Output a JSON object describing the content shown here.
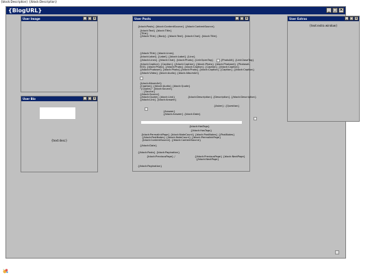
{
  "page": {
    "top_description": "{block:Description} {/block:Description}"
  },
  "main_window": {
    "title": "{BlogURL}"
  },
  "windows": {
    "user_image": {
      "title": "User Image"
    },
    "user_bio": {
      "title": "User Bio",
      "text": "{text:desc}"
    },
    "user_posts": {
      "title": "User Posts"
    },
    "user_extras": {
      "title": "User Extras",
      "text": "{text:extra window}"
    }
  },
  "posts": {
    "l01": "{block:Posts} {block:ContentSource} {/block:ContentSource}",
    "l02": "{block:Text} {block:Title}",
    "l03": "{Title}",
    "l04": "{/block:Title} {Body} {/block:Text} {block:Chat} {block:Title}",
    "l05": "{/block:Title} {block:Lines}",
    "l06": "{block:Label} {Label} {/block:Label} {Line}",
    "l07": "{/block:Lines} {/block:Chat} {block:Photo} {LinkOpenTag}",
    "l08": "{PhotoAlt} {LinkCloseTag}",
    "l09": "{block:Caption} {Caption} {/block:Caption} {/block:Photo} {block:Photoset} {Photoset-",
    "l10": "500} {block:Photo} {/block:Photo} {block:Caption} {Caption} {/block:Caption}",
    "l11": "{/block:Photoset} {block:Photo}{/block:Photo} {block:Caption} {Caption} {/block:Caption}",
    "l12": "{/block:Video} {block:Audio} {block:AlbumArt}",
    "l13": "{block:AlbumArt}",
    "l14": "{Caption} {/block:Audio} {block:Quote}",
    "l15": "\"{Quote}\" {block:Source}",
    "l16": "- {Source}",
    "l17": "{/block:Source}",
    "l18": "{/block:Quote} {block:Link}",
    "l19": "{block:Description} {Description} {/block:Description}",
    "l20": "{/block:Link} {block:Answer}",
    "l21": "{Asker}: {Question}",
    "l22": "{Answer}",
    "l23": "{/block:Answer} {block:Date}",
    "l24": "{block:HasTags}",
    "l25": "{/block:HasTags}",
    "l26": "{block:PermalinkPage} {block:NoteCount} {block:PostNotes} {/PostNotes}",
    "l27": "{/block:PostNotes} {/block:NoteCount} {/block:PermalinkPage}",
    "l28": "{block:ContentSource} {/block:ContentSource}",
    "l29": "{/block:Date}",
    "l30": "{/block:Posts} {block:Pagination}",
    "l31": "{block:PreviousPage} /",
    "l32": "{/block:PreviousPage} {block:NextPage}",
    "l33": "{/block:NextPage}",
    "l34": "{/block:Pagination}"
  },
  "icons": {
    "minimize": "_",
    "maximize": "□",
    "close": "×",
    "window_control_names": [
      "minimize-icon",
      "maximize-icon",
      "close-icon"
    ]
  },
  "colors": {
    "title_bar": "#0a246a",
    "workspace": "#c0c0c0",
    "title_text": "#ffffff"
  }
}
